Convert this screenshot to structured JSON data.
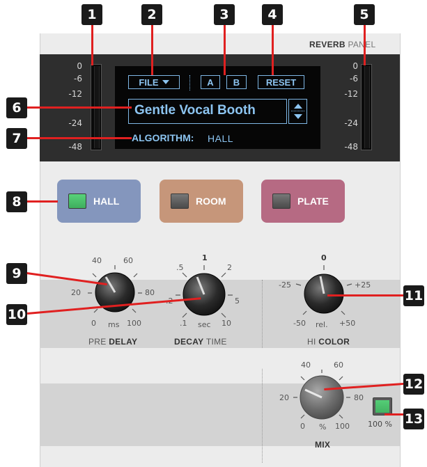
{
  "panel": {
    "title_bold": "REVERB",
    "title_light": "PANEL"
  },
  "callouts": [
    "1",
    "2",
    "3",
    "4",
    "5",
    "6",
    "7",
    "8",
    "9",
    "10",
    "11",
    "12",
    "13"
  ],
  "meters": {
    "scale": [
      "0",
      "-6",
      "-12",
      "-24",
      "-48"
    ]
  },
  "lcd": {
    "file_label": "FILE",
    "a_label": "A",
    "b_label": "B",
    "reset_label": "RESET",
    "preset_name": "Gentle Vocal Booth",
    "algorithm_caption": "ALGORITHM:",
    "algorithm_value": "HALL"
  },
  "algorithms": [
    {
      "label": "HALL",
      "active": true,
      "color": "#8496bd"
    },
    {
      "label": "ROOM",
      "active": false,
      "color": "#c6967a"
    },
    {
      "label": "PLATE",
      "active": false,
      "color": "#b66a83"
    }
  ],
  "knobs": {
    "pre_delay": {
      "ticks": [
        "40",
        "60",
        "20",
        "80",
        "0",
        "100"
      ],
      "unit": "ms",
      "label_bold": "PRE",
      "label_rest": "DELAY"
    },
    "decay_time": {
      "ticks": [
        "1",
        ".5",
        "2",
        ".2",
        "5",
        ".1",
        "10"
      ],
      "unit": "sec",
      "label_bold": "DECAY",
      "label_rest": "TIME"
    },
    "hi_color": {
      "ticks": [
        "0",
        "-25",
        "+25",
        "-50",
        "+50"
      ],
      "unit": "rel.",
      "label_bold": "HI",
      "label_rest": "COLOR"
    },
    "mix": {
      "ticks": [
        "40",
        "60",
        "20",
        "80",
        "0",
        "100"
      ],
      "unit": "%",
      "label_bold": "MIX"
    }
  },
  "mix_switch_label": "100 %",
  "colors": {
    "callout_line": "#e02020",
    "lcd_text": "#8cc4f0",
    "led_on": "#58d27a"
  }
}
